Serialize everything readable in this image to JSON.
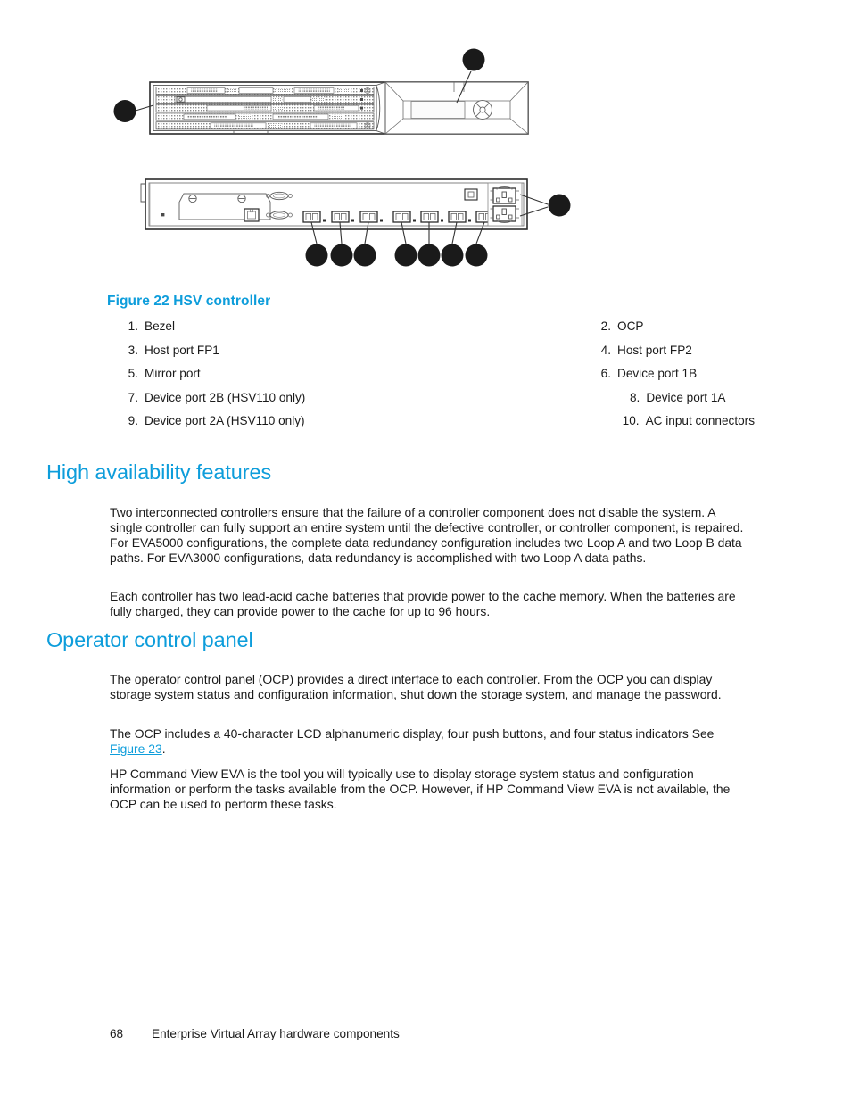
{
  "figure": {
    "caption": "Figure 22 HSV controller",
    "callouts": [
      {
        "n": "1",
        "target": "bezel"
      },
      {
        "n": "2",
        "target": "ocp"
      },
      {
        "n": "3",
        "target": "host-port-fp1"
      },
      {
        "n": "4",
        "target": "host-port-fp2"
      },
      {
        "n": "5",
        "target": "mirror-port"
      },
      {
        "n": "6",
        "target": "device-port-1b"
      },
      {
        "n": "7",
        "target": "device-port-2b"
      },
      {
        "n": "8",
        "target": "device-port-1a"
      },
      {
        "n": "9",
        "target": "device-port-2a"
      },
      {
        "n": "10",
        "target": "ac-input-connectors"
      }
    ],
    "legend": [
      {
        "num": "1.",
        "label": "Bezel",
        "num2": "2.",
        "label2": "OCP"
      },
      {
        "num": "3.",
        "label": "Host port FP1",
        "num2": "4.",
        "label2": "Host port FP2"
      },
      {
        "num": "5.",
        "label": "Mirror port",
        "num2": "6.",
        "label2": "Device port 1B"
      },
      {
        "num": "7.",
        "label": "Device port 2B (HSV110 only)",
        "num2": "8.",
        "label2": "Device port 1A"
      },
      {
        "num": "9.",
        "label": "Device port 2A (HSV110 only)",
        "num2": "10.",
        "label2": "AC input connectors"
      }
    ]
  },
  "sections": {
    "high_availability": {
      "heading": "High availability features",
      "paragraph_1": "Two interconnected controllers ensure that the failure of a controller component does not disable the system.  A single controller can fully support an entire system until the defective controller, or controller component, is repaired.  For EVA5000 configurations, the complete data redundancy configuration includes two Loop A and two Loop B data paths.  For EVA3000 configurations, data redundancy is accomplished with two Loop A data paths.",
      "paragraph_2": "Each controller has two lead-acid cache batteries that provide power to the cache memory.  When the batteries are fully charged, they can provide power to the cache for up to 96 hours."
    },
    "operator_control_panel": {
      "heading": "Operator control panel",
      "paragraph_1": "The operator control panel (OCP) provides a direct interface to each controller.  From the OCP you can display storage system status and configuration information, shut down the storage system, and manage the password.",
      "paragraph_2_before": "The OCP includes a 40-character LCD alphanumeric display, four push buttons, and four status indicators See ",
      "paragraph_2_link": "Figure 23",
      "paragraph_2_after": ".",
      "paragraph_3": "HP Command View EVA is the tool you will typically use to display storage system status and configuration information or perform the tasks available from the OCP. However, if HP Command View EVA is not available, the OCP can be used to perform these tasks."
    }
  },
  "footer": {
    "page_number": "68",
    "title": "Enterprise Virtual Array hardware components"
  },
  "colors": {
    "heading_blue": "#0d9ddb",
    "body_text": "#1a1a1a",
    "callout_fill": "#1a1a1a",
    "line_stroke": "#333333"
  }
}
